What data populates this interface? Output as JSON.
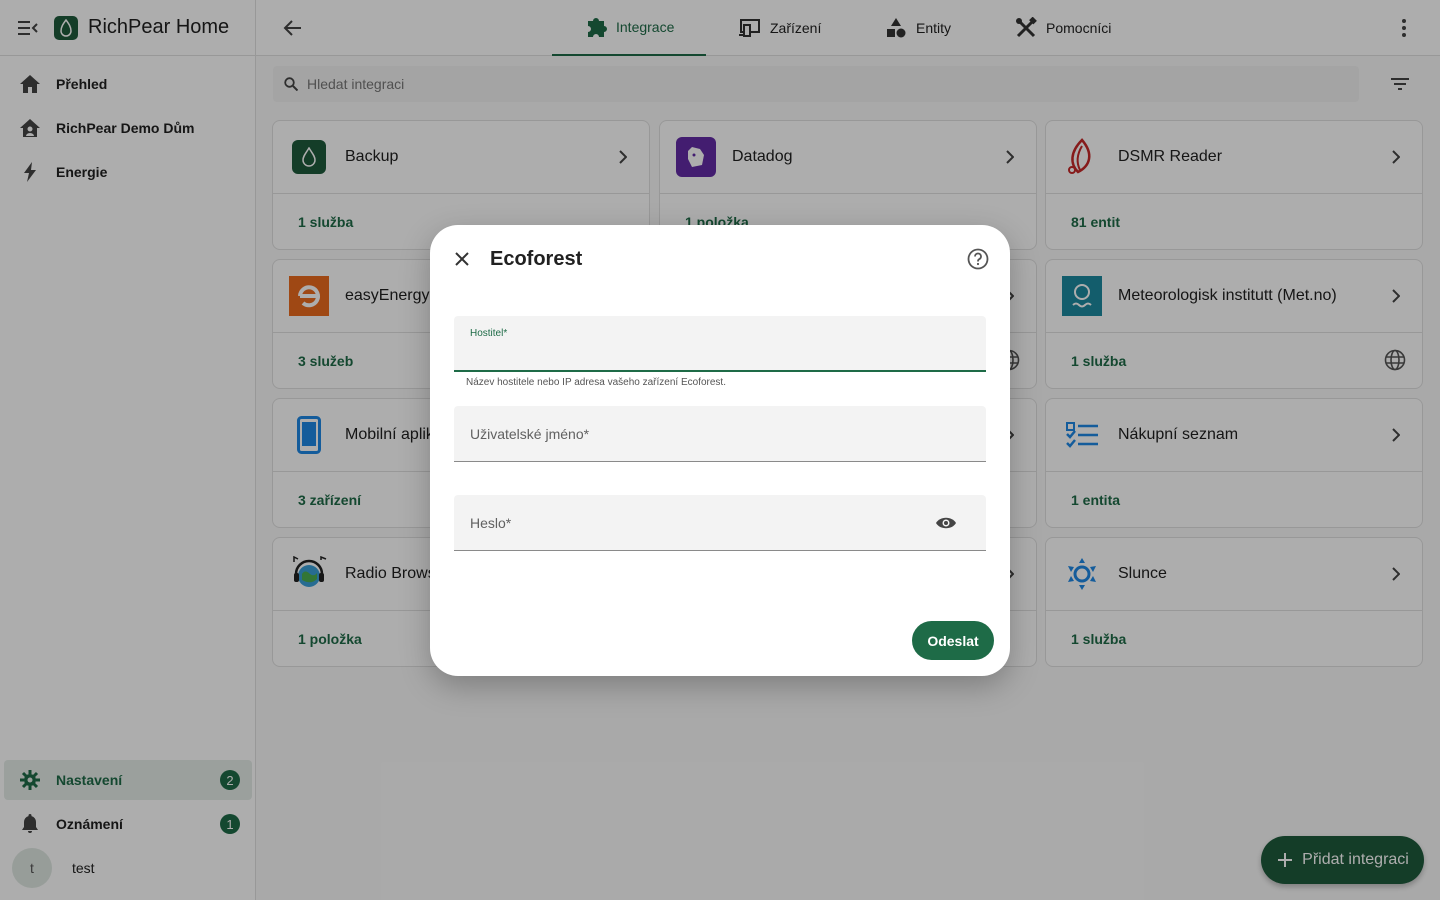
{
  "sidebar": {
    "app_title": "RichPear Home",
    "items": [
      {
        "label": "Přehled",
        "icon": "home-icon"
      },
      {
        "label": "RichPear Demo Dům",
        "icon": "home-account-icon"
      },
      {
        "label": "Energie",
        "icon": "lightning-bolt-icon"
      }
    ],
    "bottom": {
      "settings": {
        "label": "Nastavení",
        "badge": "2",
        "icon": "gear-icon"
      },
      "notifications": {
        "label": "Oznámení",
        "badge": "1",
        "icon": "bell-icon"
      },
      "user": {
        "avatar_letter": "t",
        "name": "test"
      }
    }
  },
  "topbar": {
    "tabs": [
      {
        "label": "Integrace",
        "icon": "puzzle-icon",
        "active": true
      },
      {
        "label": "Zařízení",
        "icon": "devices-icon",
        "active": false
      },
      {
        "label": "Entity",
        "icon": "shapes-icon",
        "active": false
      },
      {
        "label": "Pomocníci",
        "icon": "tools-icon",
        "active": false
      }
    ]
  },
  "search": {
    "placeholder": "Hledat integraci"
  },
  "cards": [
    {
      "name": "Backup",
      "count": "1 služba"
    },
    {
      "name": "Datadog",
      "count": "1 položka"
    },
    {
      "name": "DSMR Reader",
      "count": "81 entit"
    },
    {
      "name": "easyEnergy",
      "count": "3 služeb"
    },
    {
      "name": "Meteorologisk institutt (Met.no)",
      "count": "1 služba"
    },
    {
      "name": "Mobilní aplikace",
      "count": "3 zařízení"
    },
    {
      "name": "Nákupní seznam",
      "count": "1 entita"
    },
    {
      "name": "Radio Browser",
      "count": "1 položka"
    },
    {
      "name": "Slunce",
      "count": "1 služba"
    }
  ],
  "fab": {
    "label": "Přidat integraci"
  },
  "dialog": {
    "title": "Ecoforest",
    "fields": {
      "host": {
        "label": "Hostitel*",
        "helper": "Název hostitele nebo IP adresa vašeho zařízení Ecoforest."
      },
      "username": {
        "label": "Uživatelské jméno*"
      },
      "password": {
        "label": "Heslo*"
      }
    },
    "submit_label": "Odeslat"
  },
  "colors": {
    "accent": "#1e6b47",
    "brand": "#1e5a3c"
  }
}
